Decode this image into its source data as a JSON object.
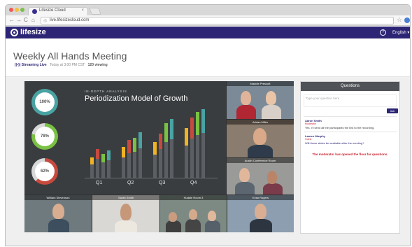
{
  "browser": {
    "tab_title": "Lifesize Cloud",
    "tab_close": "×",
    "url": "live.lifesizecloud.com",
    "back": "←",
    "forward": "→",
    "reload": "C",
    "home": "⌂",
    "lock": "◎",
    "bookmark": "☆"
  },
  "appbar": {
    "logo": "lifesize",
    "help": "?",
    "language": "English ▾",
    "brand_color": "#2c2475"
  },
  "header": {
    "title": "Weekly All Hands Meeting",
    "live_label": "((•)) Streaming Live",
    "time": "Today at 3:00 PM CST",
    "viewers": "120 viewing"
  },
  "slide": {
    "kicker": "IN-DEPTH ANALYSIS",
    "title": "Periodization Model of Growth",
    "gauges": [
      {
        "label": "100%",
        "value": 100,
        "color": "#4aa3a3"
      },
      {
        "label": "78%",
        "value": 78,
        "color": "#7ac143"
      },
      {
        "label": "62%",
        "value": 62,
        "color": "#c74a3e"
      }
    ],
    "quarters": [
      "Q1",
      "Q2",
      "Q3",
      "Q4"
    ]
  },
  "chart_data": {
    "type": "bar",
    "categories": [
      "Q1",
      "Q2",
      "Q3",
      "Q4"
    ],
    "series": [
      {
        "values": [
          30,
          45,
          52,
          72
        ],
        "color": "#f0b323"
      },
      {
        "values": [
          42,
          55,
          64,
          88
        ],
        "color": "#c74a3e"
      },
      {
        "values": [
          35,
          58,
          80,
          96
        ],
        "color": "#7ac143"
      },
      {
        "values": [
          40,
          66,
          86,
          100
        ],
        "color": "#4aa3a3"
      }
    ],
    "ylim": [
      0,
      100
    ]
  },
  "participants": [
    {
      "name": "Maddie Prescott"
    },
    {
      "name": "Adrian Miller"
    },
    {
      "name": "Austin Conference Room"
    },
    {
      "name": "Evan Rogers"
    },
    {
      "name": "William Stevenson"
    },
    {
      "name": "Sarah Smith"
    },
    {
      "name": "Huddle Room 3"
    },
    {
      "name": ""
    }
  ],
  "questions": {
    "header": "Questions",
    "placeholder": "Type your question here",
    "ask_label": "Ask",
    "items": [
      {
        "name": "Aaron Smith",
        "role": "Moderator",
        "text": "Yes, I'll send all the participants the link to the recording."
      },
      {
        "name": "Lauren Murphy",
        "role": "Guest",
        "text": "Will these slides be available after the meeting?"
      }
    ],
    "note": "The moderator has opened the floor for questions."
  }
}
